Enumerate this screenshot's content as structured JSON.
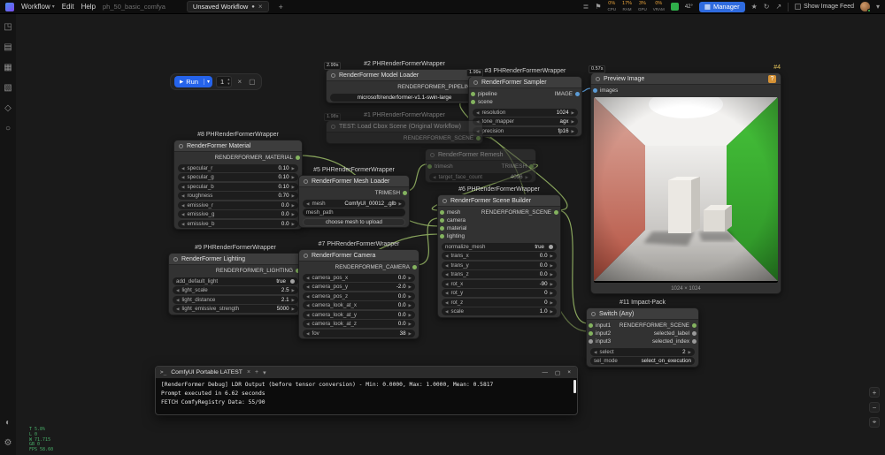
{
  "menubar": {
    "menus": [
      "Workflow",
      "Edit",
      "Help"
    ],
    "workflow_name": "ph_50_basic_comfya",
    "tab_label": "Unsaved Workflow",
    "manager_label": "Manager",
    "image_feed_label": "Show Image Feed",
    "meters": [
      {
        "label": "CPU",
        "value": "0%"
      },
      {
        "label": "RAM",
        "value": "17%"
      },
      {
        "label": "GPU",
        "value": "3%"
      },
      {
        "label": "VRAM",
        "value": "0%"
      }
    ],
    "temp": "42°"
  },
  "run_panel": {
    "run_label": "Run",
    "count": "1"
  },
  "icons": {
    "caret-down": "▾",
    "close": "×",
    "plus": "+",
    "unsaved-dot": "●",
    "play": "▶",
    "step-up": "▴",
    "step-down": "▾",
    "stop-square": "▢",
    "minus": "−",
    "fit": "⌖",
    "window-min": "—",
    "window-max": "▢",
    "terminal": "&gt;_",
    "queue": "≣",
    "bookmark": "⚑",
    "star": "★",
    "history": "↻",
    "share": "↗",
    "apps": "▦",
    "workflows": "◳",
    "templates": "▤",
    "models": "▦",
    "browse": "▧",
    "custom-nodes": "◇",
    "gallery": "○",
    "theme": "◐",
    "settings": "⚙"
  },
  "nodes": {
    "model_loader": {
      "group": "#2 PHRenderFormerWrapper",
      "badge": "2.99s",
      "title": "RenderFormer Model Loader",
      "outputs": [
        "RENDERFORMER_PIPELINE"
      ],
      "widgets": [
        {
          "value": "microsoft/renderformer-v1.1-swin-large"
        }
      ]
    },
    "sampler": {
      "group": "#3 PHRenderFormerWrapper",
      "badge": "1.99s",
      "title": "RenderFormer Sampler",
      "inputs": [
        "pipeline",
        "scene"
      ],
      "outputs": [
        "IMAGE"
      ],
      "widgets": [
        {
          "name": "resolution",
          "value": "1024"
        },
        {
          "name": "tone_mapper",
          "value": "agx"
        },
        {
          "name": "precision",
          "value": "fp16"
        }
      ]
    },
    "test_loader": {
      "group": "#1 PHRenderFormerWrapper",
      "badge": "1.98s",
      "title": "TEST: Load Cbox Scene (Original Workflow)",
      "outputs": [
        "RENDERFORMER_SCENE"
      ]
    },
    "material": {
      "group": "#8 PHRenderFormerWrapper",
      "title": "RenderFormer Material",
      "outputs": [
        "RENDERFORMER_MATERIAL"
      ],
      "widgets": [
        {
          "name": "specular_r",
          "value": "0.10"
        },
        {
          "name": "specular_g",
          "value": "0.10"
        },
        {
          "name": "specular_b",
          "value": "0.10"
        },
        {
          "name": "roughness",
          "value": "0.70"
        },
        {
          "name": "emissive_r",
          "value": "0.0"
        },
        {
          "name": "emissive_g",
          "value": "0.0"
        },
        {
          "name": "emissive_b",
          "value": "0.0"
        }
      ]
    },
    "mesh_loader": {
      "group": "#5 PHRenderFormerWrapper",
      "title": "RenderFormer Mesh Loader",
      "outputs": [
        "TRIMESH"
      ],
      "widgets": [
        {
          "name": "mesh",
          "value": "ComfyUI_00012_.glb"
        },
        {
          "name": "mesh_path"
        },
        {
          "label": "choose mesh to upload"
        }
      ]
    },
    "remesh": {
      "title": "RenderFormer Remesh",
      "inputs": [
        "trimesh"
      ],
      "outputs": [
        "TRIMESH"
      ],
      "widgets": [
        {
          "name": "target_face_count",
          "value": "4096"
        }
      ]
    },
    "scene_builder": {
      "group": "#6 PHRenderFormerWrapper",
      "title": "RenderFormer Scene Builder",
      "inputs": [
        "mesh",
        "camera",
        "material",
        "lighting"
      ],
      "outputs": [
        "RENDERFORMER_SCENE"
      ],
      "widgets": [
        {
          "name": "normalize_mesh",
          "value": "true"
        },
        {
          "name": "trans_x",
          "value": "0.0"
        },
        {
          "name": "trans_y",
          "value": "0.0"
        },
        {
          "name": "trans_z",
          "value": "0.0"
        },
        {
          "name": "rot_x",
          "value": "-90"
        },
        {
          "name": "rot_y",
          "value": "0"
        },
        {
          "name": "rot_z",
          "value": "0"
        },
        {
          "name": "scale",
          "value": "1.0"
        }
      ]
    },
    "lighting": {
      "group": "#9 PHRenderFormerWrapper",
      "title": "RenderFormer Lighting",
      "outputs": [
        "RENDERFORMER_LIGHTING"
      ],
      "widgets": [
        {
          "name": "add_default_light",
          "value": "true"
        },
        {
          "name": "light_scale",
          "value": "2.5"
        },
        {
          "name": "light_distance",
          "value": "2.1"
        },
        {
          "name": "light_emissive_strength",
          "value": "5000"
        }
      ]
    },
    "camera": {
      "group": "#7 PHRenderFormerWrapper",
      "title": "RenderFormer Camera",
      "outputs": [
        "RENDERFORMER_CAMERA"
      ],
      "widgets": [
        {
          "name": "camera_pos_x",
          "value": "0.0"
        },
        {
          "name": "camera_pos_y",
          "value": "-2.0"
        },
        {
          "name": "camera_pos_z",
          "value": "0.0"
        },
        {
          "name": "camera_look_at_x",
          "value": "0.0"
        },
        {
          "name": "camera_look_at_y",
          "value": "0.0"
        },
        {
          "name": "camera_look_at_z",
          "value": "0.0"
        },
        {
          "name": "fov",
          "value": "38"
        }
      ]
    },
    "preview": {
      "group": "#4",
      "badge": "0.57s",
      "title": "Preview Image",
      "help": "?",
      "inputs": [
        "images"
      ],
      "caption": "1024 × 1024"
    },
    "switch_any": {
      "group": "#11 Impact-Pack",
      "title": "Switch (Any)",
      "inputs": [
        "input1",
        "input2",
        "input3"
      ],
      "outputs": [
        "RENDERFORMER_SCENE",
        "selected_label",
        "selected_index"
      ],
      "widgets": [
        {
          "name": "select",
          "value": "2"
        },
        {
          "name": "sel_mode",
          "value": "select_on_execution"
        }
      ]
    }
  },
  "console": {
    "title": "ComfyUI Portable LATEST",
    "lines": [
      "[RenderFormer Debug] LDR Output (before tensor conversion) - Min: 0.0000, Max: 1.0000, Mean: 0.5817",
      "Prompt executed in 6.62 seconds",
      "FETCH ComfyRegistry Data: 55/90"
    ]
  },
  "perf_stats": [
    "T 5.8%",
    "L 0",
    "W 71.715",
    "GB 0",
    "FPS 58.60"
  ]
}
